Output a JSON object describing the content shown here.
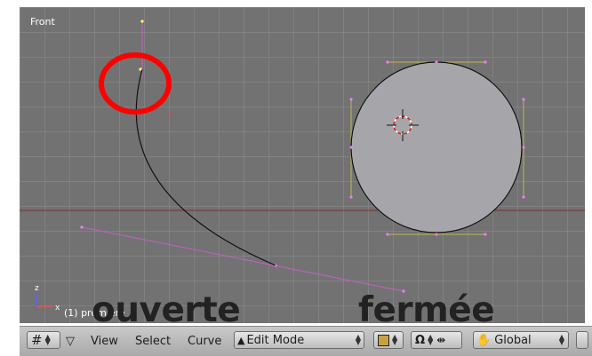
{
  "viewport": {
    "view_name": "Front",
    "object_label": "(1) premiere",
    "axis_z": "z",
    "axis_x": "x"
  },
  "captions": {
    "open": "ouverte",
    "closed": "fermée"
  },
  "header": {
    "menus": [
      "View",
      "Select",
      "Curve"
    ],
    "mode": "Edit Mode",
    "orientation": "Global"
  },
  "colors": {
    "viewport_bg": "#727272",
    "curve_handle": "#c261c6",
    "circle_fill": "#a6a6aa",
    "circle_handle": "#b9b94a",
    "highlight_ring": "#ff0000",
    "axis_line": "#7a3030"
  },
  "icons": [
    "grid-icon",
    "view-menu-arrow-icon",
    "edit-mode-icon",
    "draw-type-icon",
    "snap-icon",
    "hand-icon",
    "manipulator-icon"
  ]
}
